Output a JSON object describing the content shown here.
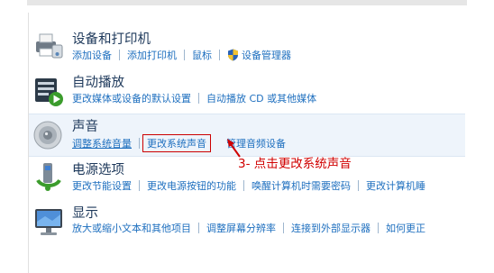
{
  "items": [
    {
      "title": "设备和打印机",
      "links": [
        "添加设备",
        "添加打印机",
        "鼠标",
        "设备管理器"
      ]
    },
    {
      "title": "自动播放",
      "links": [
        "更改媒体或设备的默认设置",
        "自动播放 CD 或其他媒体"
      ]
    },
    {
      "title": "声音",
      "links": [
        "调整系统音量",
        "更改系统声音",
        "管理音频设备"
      ]
    },
    {
      "title": "电源选项",
      "links": [
        "更改节能设置",
        "更改电源按钮的功能",
        "唤醒计算机时需要密码",
        "更改计算机睡"
      ]
    },
    {
      "title": "显示",
      "links": [
        "放大或缩小文本和其他项目",
        "调整屏幕分辨率",
        "连接到外部显示器",
        "如何更正"
      ]
    }
  ],
  "annotation": {
    "text": "3- 点击更改系统声音",
    "color": "#d00000"
  }
}
